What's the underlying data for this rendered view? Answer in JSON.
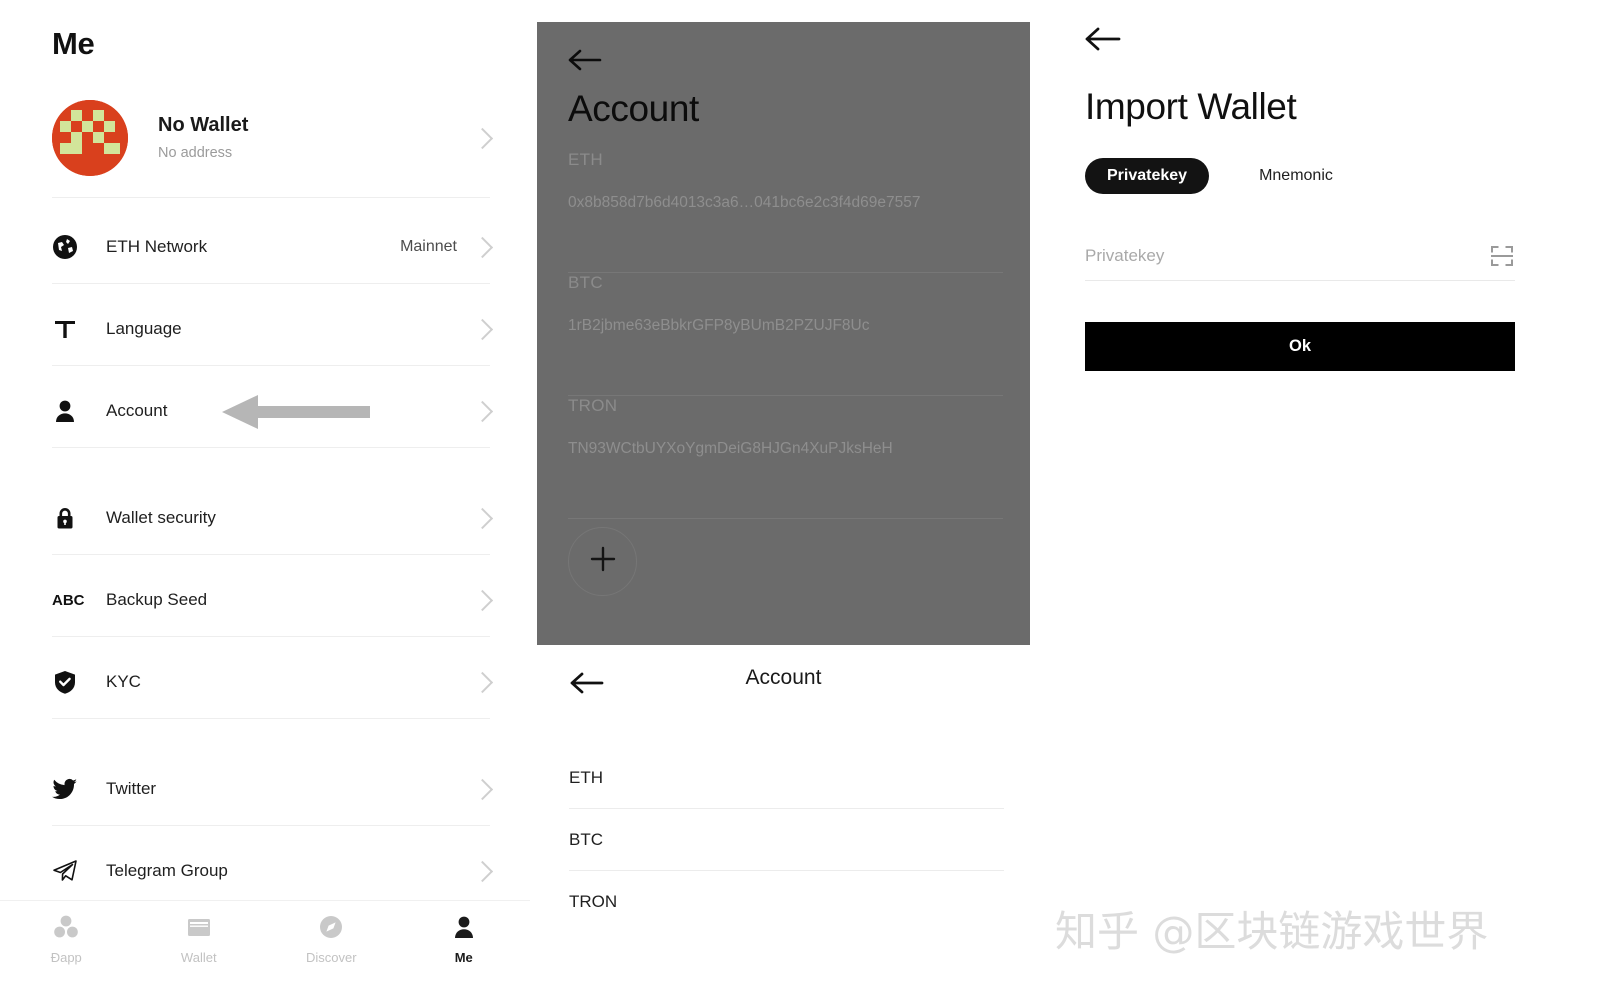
{
  "me_screen": {
    "title": "Me",
    "profile": {
      "name": "No Wallet",
      "address": "No address",
      "avatar_icon": "identicon-avatar",
      "avatar_bg_color": "#d9401d",
      "avatar_fg_color": "#d2e59a"
    },
    "menu_items": [
      {
        "icon": "globe-icon",
        "label": "ETH Network",
        "value": "Mainnet"
      },
      {
        "icon": "text-t-icon",
        "label": "Language",
        "value": ""
      },
      {
        "icon": "person-icon",
        "label": "Account",
        "value": ""
      },
      {
        "icon": "lock-icon",
        "label": "Wallet security",
        "value": ""
      },
      {
        "icon": "abc-icon",
        "label": "Backup Seed",
        "value": ""
      },
      {
        "icon": "shield-check-icon",
        "label": "KYC",
        "value": ""
      },
      {
        "icon": "twitter-icon",
        "label": "Twitter",
        "value": ""
      },
      {
        "icon": "telegram-icon",
        "label": "Telegram Group",
        "value": ""
      }
    ],
    "tabbar": [
      {
        "icon": "dapp-icon",
        "label": "Ðapp",
        "active": false
      },
      {
        "icon": "wallet-icon",
        "label": "Wallet",
        "active": false
      },
      {
        "icon": "compass-icon",
        "label": "Discover",
        "active": false
      },
      {
        "icon": "person-icon",
        "label": "Me",
        "active": true
      }
    ],
    "annotation": {
      "type": "left-arrow",
      "color": "#b6b6b6"
    }
  },
  "account_screen_dim": {
    "back_icon": "back-arrow-icon",
    "title": "Account",
    "overlay_color": "#6b6b6b",
    "accounts": [
      {
        "coin": "ETH",
        "address": "0x8b858d7b6d4013c3a6…041bc6e2c3f4d69e7557"
      },
      {
        "coin": "BTC",
        "address": "1rB2jbme63eBbkrGFP8yBUmB2PZUJF8Uc"
      },
      {
        "coin": "TRON",
        "address": "TN93WCtbUYXoYgmDeiG8HJGn4XuPJksHeH"
      }
    ],
    "add_button_icon": "plus-icon"
  },
  "account_screen_list": {
    "back_icon": "back-arrow-icon",
    "title": "Account",
    "coins": [
      "ETH",
      "BTC",
      "TRON"
    ]
  },
  "import_wallet_screen": {
    "back_icon": "back-arrow-icon",
    "title": "Import Wallet",
    "tabs": [
      {
        "label": "Privatekey",
        "selected": true
      },
      {
        "label": "Mnemonic",
        "selected": false
      }
    ],
    "input": {
      "value": "",
      "placeholder": "Privatekey",
      "trailing_icon": "qr-scan-icon"
    },
    "submit_label": "Ok",
    "submit_color": "#000000"
  },
  "watermark": {
    "text": "知乎 @区块链游戏世界"
  }
}
